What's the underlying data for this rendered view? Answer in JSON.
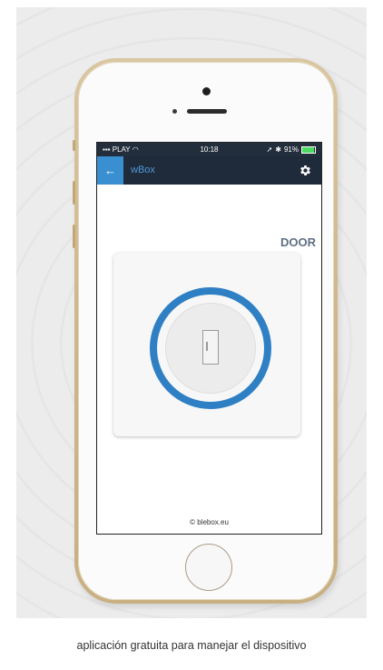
{
  "status_bar": {
    "carrier": "PLAY",
    "time": "10:18",
    "battery": "91%",
    "battery_level": 0.91
  },
  "app_bar": {
    "back_icon": "back-arrow-icon",
    "title": "wBox",
    "settings_icon": "gear-icon"
  },
  "main": {
    "device_label": "DOOR",
    "door_button_icon": "door-icon"
  },
  "footer": {
    "text": "© blebox.eu"
  },
  "caption": "aplicación gratuita para manejar el dispositivo",
  "colors": {
    "accent": "#2f7fc4",
    "header_bg": "#1f2b3a",
    "back_button": "#3a8fd0",
    "battery": "#4cd964"
  }
}
